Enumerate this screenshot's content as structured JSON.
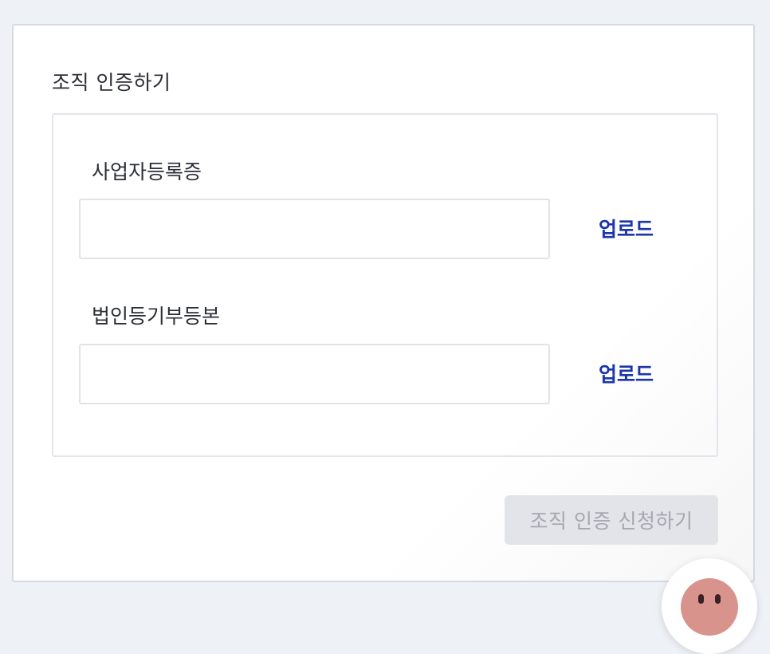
{
  "org_verification": {
    "title": "조직 인증하기",
    "fields": [
      {
        "label": "사업자등록증",
        "upload_label": "업로드",
        "file_value": ""
      },
      {
        "label": "법인등기부등본",
        "upload_label": "업로드",
        "file_value": ""
      }
    ],
    "submit_label": "조직 인증 신청하기"
  },
  "colors": {
    "page_background": "#eef1f6",
    "upload_link": "#1c36a8",
    "disabled_button_bg": "#e2e4e9",
    "disabled_button_text": "#a5a8b0",
    "chat_face": "#d8948c"
  },
  "chat_widget": {
    "icon": "chat-avatar-icon"
  }
}
